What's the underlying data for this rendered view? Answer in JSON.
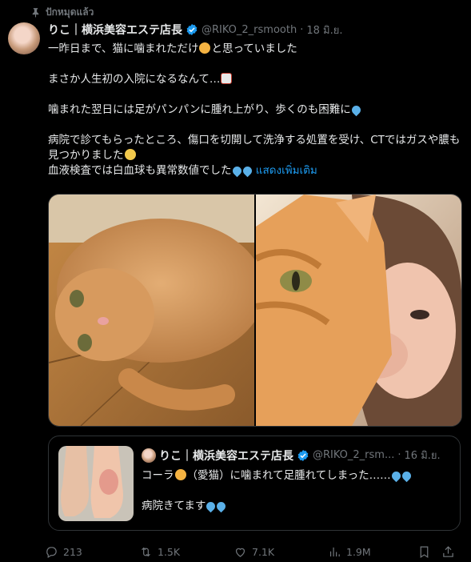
{
  "pinned": {
    "label": "ปักหมุดแล้ว"
  },
  "tweet": {
    "author_name": "りこ｜横浜美容エステ店長",
    "handle": "@RIKO_2_rsmooth",
    "separator": "·",
    "date": "18 มิ.ย.",
    "lines": [
      "一昨日まで、猫に噛まれただけ",
      "と思っていました",
      "まさか人生初の入院になるなんて…",
      "噛まれた翌日には足がパンパンに腫れ上がり、歩くのも困難に",
      "病院で診てもらったところ、傷口を切開して洗浄する処置を受け、CTではガスや膿も見つかりました",
      "血液検査では白血球も異常数値でした"
    ],
    "show_more": "แสดงเพิ่มเติม"
  },
  "quote": {
    "author_name": "りこ｜横浜美容エステ店長",
    "handle": "@RIKO_2_rsm...",
    "separator": "·",
    "date": "16 มิ.ย.",
    "line1_a": "コーラ",
    "line1_b": "（愛猫）に噛まれて足腫れてしまった……",
    "line2": "病院きてます"
  },
  "actions": {
    "replies": "213",
    "reposts": "1.5K",
    "likes": "7.1K",
    "views": "1.9M"
  },
  "icons": [
    "pin-icon",
    "verified-badge-icon",
    "reply-icon",
    "repost-icon",
    "like-icon",
    "views-icon",
    "bookmark-icon",
    "share-icon"
  ],
  "colors": {
    "background": "#000000",
    "text": "#e7e9ea",
    "muted": "#71767b",
    "link": "#1d9bf0",
    "verified": "#1d9bf0",
    "border": "#2f3336"
  }
}
